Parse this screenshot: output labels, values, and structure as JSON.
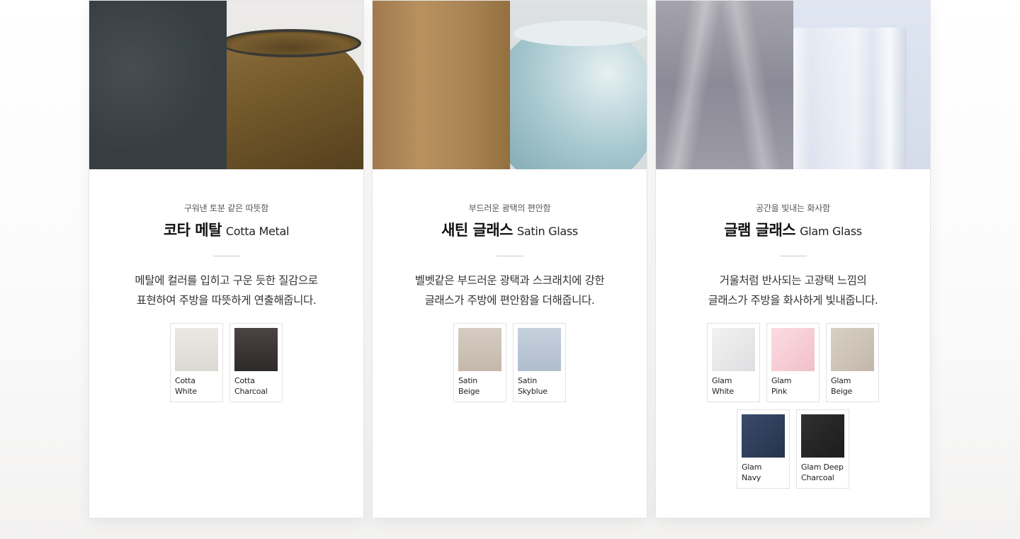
{
  "cards": [
    {
      "kicker": "구워낸 토분 같은 따뜻함",
      "title_ko": "코타 메탈",
      "title_en": "Cotta Metal",
      "desc": [
        "메탈에 컬러를 입히고 구운 듯한 질감으로",
        "표현하여 주방을 따뜻하게 연출해줍니다."
      ],
      "swatches": [
        {
          "line1": "Cotta",
          "line2": "White",
          "color": "#e4e1dd"
        },
        {
          "line1": "Cotta",
          "line2": "Charcoal",
          "color": "#3b3634"
        }
      ]
    },
    {
      "kicker": "부드러운 광택의 편안함",
      "title_ko": "새틴 글래스",
      "title_en": "Satin Glass",
      "desc": [
        "벨벳같은 부드러운 광택과 스크래치에 강한",
        "글래스가 주방에 편안함을 더해줍니다."
      ],
      "swatches": [
        {
          "line1": "Satin",
          "line2": "Beige",
          "color": "#cfc4b9"
        },
        {
          "line1": "Satin",
          "line2": "Skyblue",
          "color": "#bcc8d6"
        }
      ]
    },
    {
      "kicker": "공간을 빛내는 화사함",
      "title_ko": "글램 글래스",
      "title_en": "Glam Glass",
      "desc": [
        "거울처럼 반사되는 고광택 느낌의",
        "글래스가 주방을 화사하게 빛내줍니다."
      ],
      "swatches": [
        {
          "line1": "Glam",
          "line2": "White",
          "color": "#e9e9ea"
        },
        {
          "line1": "Glam",
          "line2": "Pink",
          "color": "#f6cdd5"
        },
        {
          "line1": "Glam",
          "line2": "Beige",
          "color": "#cfc5b9"
        },
        {
          "line1": "Glam",
          "line2": "Navy",
          "color": "#2f3e5c"
        },
        {
          "line1": "Glam Deep",
          "line2": "Charcoal",
          "color": "#262626"
        }
      ]
    }
  ]
}
